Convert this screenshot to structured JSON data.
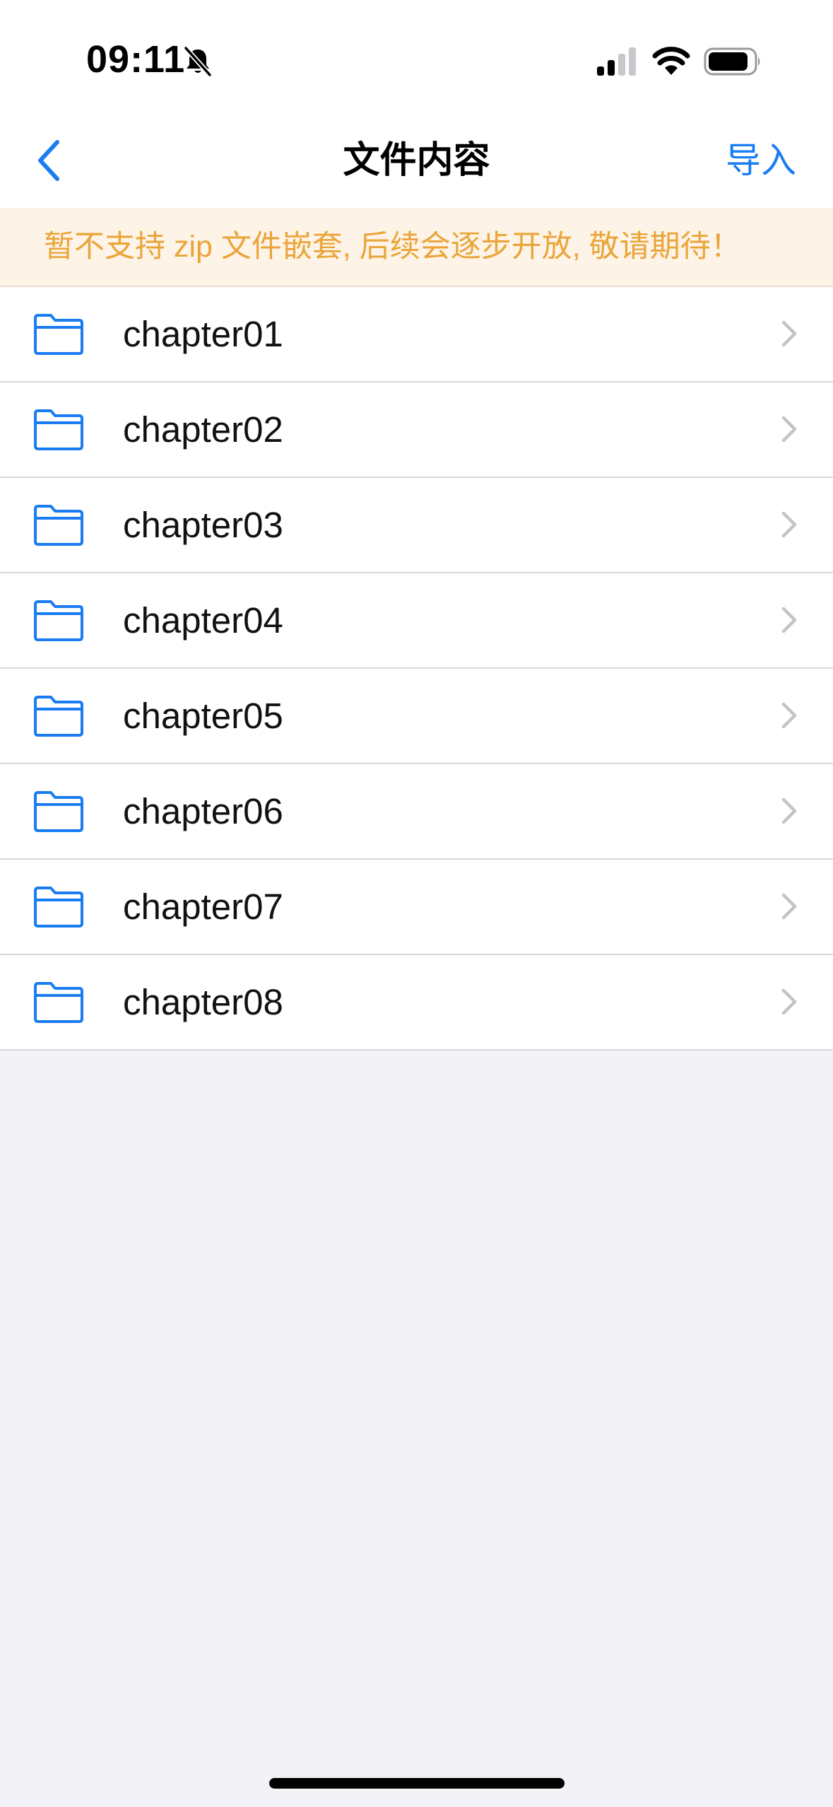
{
  "status_bar": {
    "time": "09:11",
    "icons": [
      "bell-slash-icon",
      "cellular-signal-icon",
      "wifi-icon",
      "battery-icon"
    ]
  },
  "nav": {
    "back_icon": "chevron-left-icon",
    "title": "文件内容",
    "import_label": "导入"
  },
  "notice": {
    "text": "暂不支持 zip 文件嵌套, 后续会逐步开放, 敬请期待！"
  },
  "folders": [
    {
      "name": "chapter01"
    },
    {
      "name": "chapter02"
    },
    {
      "name": "chapter03"
    },
    {
      "name": "chapter04"
    },
    {
      "name": "chapter05"
    },
    {
      "name": "chapter06"
    },
    {
      "name": "chapter07"
    },
    {
      "name": "chapter08"
    }
  ],
  "colors": {
    "accent": "#1a7cf3",
    "notice_text": "#eaa53a",
    "notice_bg": "#fdf3e6",
    "background": "#f2f2f7"
  }
}
